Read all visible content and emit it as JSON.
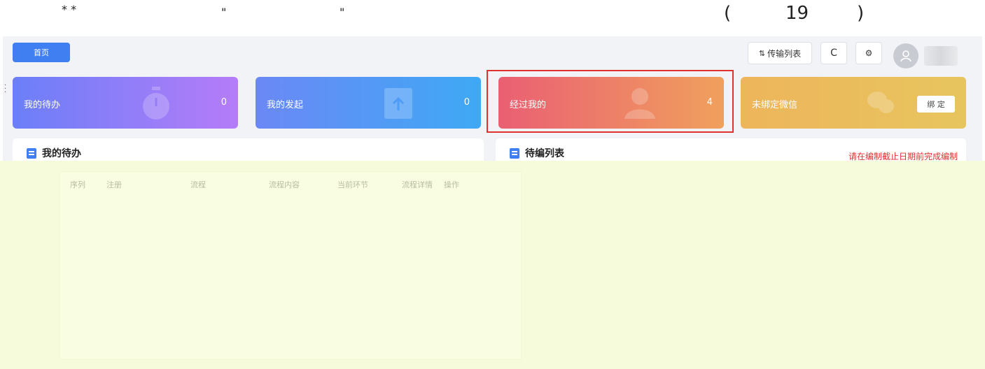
{
  "annotation": {
    "stars": "* *",
    "quote_open": "\"",
    "quote_close": "\"",
    "paren_open": "(",
    "number": "19",
    "paren_close": ")"
  },
  "header": {
    "home_label": "首页",
    "transfer_list_label": "传输列表",
    "refresh_icon": "refresh-icon",
    "settings_icon": "gear-icon"
  },
  "cards": [
    {
      "label": "我的待办",
      "count": "0",
      "icon": "stopwatch-icon"
    },
    {
      "label": "我的发起",
      "count": "0",
      "icon": "upload-icon"
    },
    {
      "label": "经过我的",
      "count": "4",
      "icon": "user-icon"
    },
    {
      "label": "未绑定微信",
      "button": "绑 定",
      "icon": "wechat-icon"
    }
  ],
  "panels": {
    "todo_title": "我的待办",
    "pending_title": "待编列表",
    "pending_hint": "请在编制截止日期前完成编制"
  },
  "table": {
    "columns": [
      "序列",
      "注册",
      "流程",
      "流程内容",
      "当前环节",
      "流程详情",
      "操作"
    ]
  },
  "colors": {
    "primary": "#3f7ff2",
    "highlight_border": "#e0312f",
    "overlay": "#f6fbdc"
  }
}
